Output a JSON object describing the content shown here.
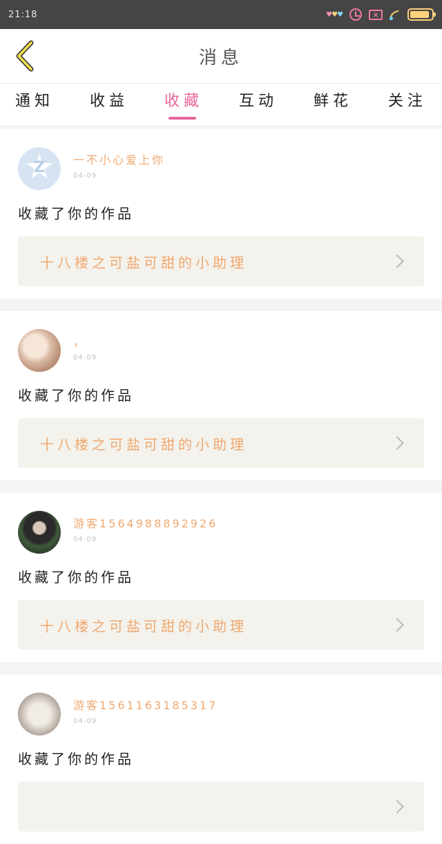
{
  "status_bar": {
    "time": "21:18",
    "icons": [
      "hearts-icon",
      "alarm-icon",
      "sim-icon",
      "wifi-icon",
      "battery-icon"
    ],
    "battery_level": 0.9
  },
  "header": {
    "title": "消息",
    "back_icon": "chevron-left-icon"
  },
  "tabs": [
    {
      "label": "通知",
      "active": false
    },
    {
      "label": "收益",
      "active": false
    },
    {
      "label": "收藏",
      "active": true
    },
    {
      "label": "互动",
      "active": false
    },
    {
      "label": "鲜花",
      "active": false
    },
    {
      "label": "关注",
      "active": false
    }
  ],
  "colors": {
    "accent": "#e8669a",
    "username": "#f0a86f",
    "work_bg": "#f3f2ec"
  },
  "messages": [
    {
      "user": "一不小心爱上你",
      "date": "04-09",
      "action": "收藏了你的作品",
      "work_title": "十八楼之可盐可甜的小助理",
      "avatar": "qq-star-avatar"
    },
    {
      "user": "，",
      "date": "04-09",
      "action": "收藏了你的作品",
      "work_title": "十八楼之可盐可甜的小助理",
      "avatar": "cat-photo-avatar"
    },
    {
      "user": "游客1564988892926",
      "date": "04-09",
      "action": "收藏了你的作品",
      "work_title": "十八楼之可盐可甜的小助理",
      "avatar": "boy-photo-avatar"
    },
    {
      "user": "游客1561163185317",
      "date": "04-09",
      "action": "收藏了你的作品",
      "work_title": "",
      "avatar": "cat-photo-avatar"
    }
  ]
}
